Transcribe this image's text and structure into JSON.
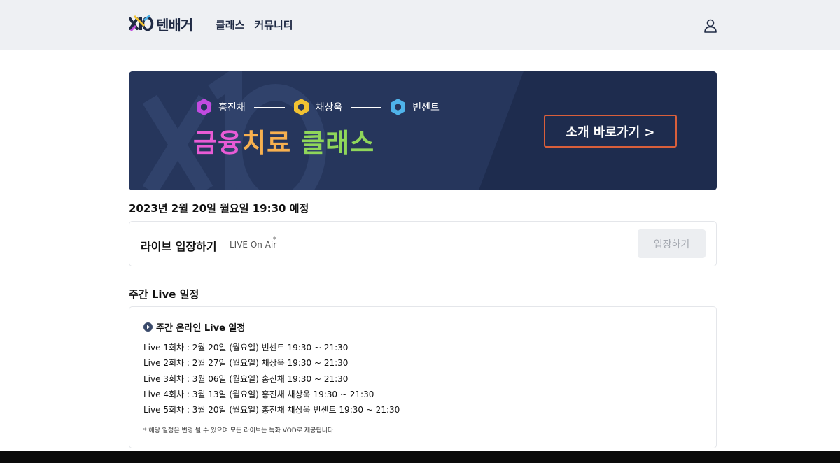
{
  "header": {
    "logo_text": "텐배거",
    "nav": [
      "클래스",
      "커뮤니티"
    ],
    "user_icon": "user-icon"
  },
  "banner": {
    "instructors": [
      {
        "name": "홍진채",
        "color": "#c24be0"
      },
      {
        "name": "채상욱",
        "color": "#f1c232"
      },
      {
        "name": "빈센트",
        "color": "#4fb3ea"
      }
    ],
    "title": [
      "금융",
      "치",
      "료 ",
      "클래스"
    ],
    "cta": "소개 바로가기 >"
  },
  "live": {
    "date": "2023년 2월 20일 월요일 19:30 예정",
    "title": "라이브 입장하기",
    "sub": "LIVE On Air",
    "sup": "*",
    "button": "입장하기"
  },
  "schedule": {
    "section_title": "주간 Live 일정",
    "heading": "주간 온라인 Live 일정",
    "items": [
      "Live 1회차 : 2월 20일 (월요일) 빈센트 19:30 ~ 21:30",
      "Live 2회차 : 2월 27일 (월요일) 채상욱 19:30 ~ 21:30",
      "Live 3회차 : 3월 06일 (월요일) 홍진채 19:30 ~ 21:30",
      "Live 4회차 : 3월 13일 (월요일) 홍진채 채상욱 19:30 ~ 21:30",
      "Live 5회차 : 3월 20일 (월요일) 홍진채 채상욱 빈센트 19:30 ~ 21:30"
    ],
    "note": "* 해당 일정은 변경 될 수 있으며 모든 라이브는 녹화 VOD로 제공됩니다"
  }
}
